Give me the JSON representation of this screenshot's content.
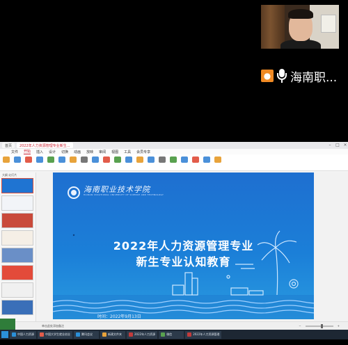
{
  "meeting": {
    "presenter_name": "海南职..."
  },
  "app": {
    "tabs": [
      "首页",
      "2022年人力资源管理专业新生..."
    ],
    "menu": [
      "文件",
      "开始",
      "插入",
      "设计",
      "切换",
      "动画",
      "放映",
      "审阅",
      "视图",
      "工具",
      "会员专享"
    ],
    "active_menu": "开始",
    "ribbon_colors": [
      "#e8a33b",
      "#4a90d9",
      "#e25c4a",
      "#4a90d9",
      "#59a14f",
      "#4a90d9",
      "#e8a33b",
      "#777777",
      "#4a90d9",
      "#e25c4a",
      "#59a14f",
      "#4a90d9",
      "#e8a33b",
      "#4a90d9",
      "#777777",
      "#59a14f",
      "#4a90d9",
      "#e25c4a",
      "#4a90d9",
      "#e8a33b"
    ],
    "thumbs_header": "大纲  幻灯片"
  },
  "slide": {
    "school_script": "海南职业技术学院",
    "school_en": "HAINAN VOCATIONAL UNIVERSITY OF SCIENCE AND TECHNOLOGY",
    "title_line1": "2022年人力资源管理专业",
    "title_line2": "新生专业认知教育",
    "date_text": "时间：2022年9月13日"
  },
  "statusbar": {
    "notes_label": "单击此处添加备注",
    "zoom_fraction": 0.6
  },
  "taskbar": {
    "items": [
      {
        "label": "中国人力资源",
        "color": "#2b90d9"
      },
      {
        "label": "中国大学生就业创业",
        "color": "#e25c4a"
      },
      {
        "label": "腾讯会议",
        "color": "#2b90d9"
      },
      {
        "label": "新建文件夹",
        "color": "#e8a33b"
      },
      {
        "label": "2022年人力资源",
        "color": "#c23b3b"
      },
      {
        "label": "微信",
        "color": "#59a14f"
      },
      {
        "label": "2022年人力资源管理",
        "color": "#c23b3b"
      }
    ]
  }
}
